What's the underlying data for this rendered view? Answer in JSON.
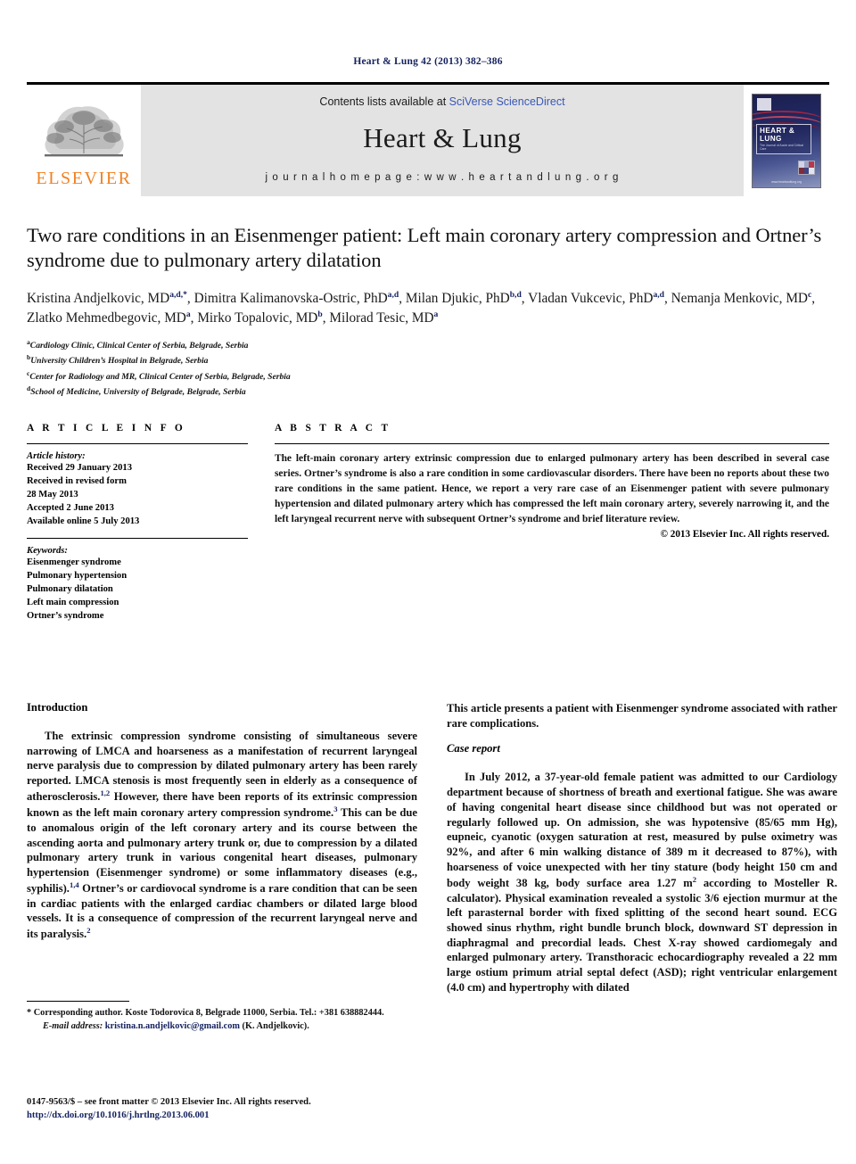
{
  "running_head": "Heart & Lung 42 (2013) 382–386",
  "masthead": {
    "publisher_logo_text": "ELSEVIER",
    "contents_prefix": "Contents lists available at ",
    "contents_link": "SciVerse ScienceDirect",
    "journal_name": "Heart & Lung",
    "homepage": "j o u r n a l   h o m e p a g e :   w w w . h e a r t a n d l u n g . o r g",
    "cover": {
      "title": "HEART & LUNG",
      "subtitle": "The Journal of Acute and Critical Care",
      "footer": "www.heartandlung.org"
    }
  },
  "article": {
    "title": "Two rare conditions in an Eisenmenger patient: Left main coronary artery compression and Ortner’s syndrome due to pulmonary artery dilatation",
    "authors_line_1": "Kristina Andjelkovic, MD",
    "authors_html": "Kristina Andjelkovic, MD a,d,*, Dimitra Kalimanovska-Ostric, PhD a,d, Milan Djukic, PhD b,d, Vladan Vukcevic, PhD a,d, Nemanja Menkovic, MD c, Zlatko Mehmedbegovic, MD a, Mirko Topalovic, MD b, Milorad Tesic, MD a",
    "authors": [
      {
        "name": "Kristina Andjelkovic, MD",
        "sup": "a,d,*"
      },
      {
        "name": "Dimitra Kalimanovska-Ostric, PhD",
        "sup": "a,d"
      },
      {
        "name": "Milan Djukic, PhD",
        "sup": "b,d"
      },
      {
        "name": "Vladan Vukcevic, PhD",
        "sup": "a,d"
      },
      {
        "name": "Nemanja Menkovic, MD",
        "sup": "c"
      },
      {
        "name": "Zlatko Mehmedbegovic, MD",
        "sup": "a"
      },
      {
        "name": "Mirko Topalovic, MD",
        "sup": "b"
      },
      {
        "name": "Milorad Tesic, MD",
        "sup": "a"
      }
    ],
    "affiliations": [
      {
        "sup": "a",
        "text": "Cardiology Clinic, Clinical Center of Serbia, Belgrade, Serbia"
      },
      {
        "sup": "b",
        "text": "University Children’s Hospital in Belgrade, Serbia"
      },
      {
        "sup": "c",
        "text": "Center for Radiology and MR, Clinical Center of Serbia, Belgrade, Serbia"
      },
      {
        "sup": "d",
        "text": "School of Medicine, University of Belgrade, Belgrade, Serbia"
      }
    ]
  },
  "article_info": {
    "heading": "A R T I C L E   I N F O",
    "history_label": "Article history:",
    "history": [
      "Received 29 January 2013",
      "Received in revised form",
      "28 May 2013",
      "Accepted 2 June 2013",
      "Available online 5 July 2013"
    ],
    "keywords_label": "Keywords:",
    "keywords": [
      "Eisenmenger syndrome",
      "Pulmonary hypertension",
      "Pulmonary dilatation",
      "Left main compression",
      "Ortner’s syndrome"
    ]
  },
  "abstract": {
    "heading": "A B S T R A C T",
    "text": "The left-main coronary artery extrinsic compression due to enlarged pulmonary artery has been described in several case series. Ortner’s syndrome is also a rare condition in some cardiovascular disorders. There have been no reports about these two rare conditions in the same patient. Hence, we report a very rare case of an Eisenmenger patient with severe pulmonary hypertension and dilated pulmonary artery which has compressed the left main coronary artery, severely narrowing it, and the left laryngeal recurrent nerve with subsequent Ortner’s syndrome and brief literature review.",
    "copyright": "© 2013 Elsevier Inc. All rights reserved."
  },
  "body": {
    "left": {
      "heading": "Introduction",
      "paragraph_1_a": "The extrinsic compression syndrome consisting of simultaneous severe narrowing of LMCA and hoarseness as a manifestation of recurrent laryngeal nerve paralysis due to compression by dilated pulmonary artery has been rarely reported. LMCA stenosis is most frequently seen in elderly as a consequence of atherosclerosis.",
      "ref_1": "1,2",
      "paragraph_1_b": " However, there have been reports of its extrinsic compression known as the left main coronary artery compression syndrome.",
      "ref_2": "3",
      "paragraph_1_c": " This can be due to anomalous origin of the left coronary artery and its course between the ascending aorta and pulmonary artery trunk or, due to compression by a dilated pulmonary artery trunk in various congenital heart diseases, pulmonary hypertension (Eisenmenger syndrome) or some inflammatory diseases (e.g., syphilis).",
      "ref_3": "1,4",
      "paragraph_1_d": " Ortner’s or cardiovocal syndrome is a rare condition that can be seen in cardiac patients with the enlarged cardiac chambers or dilated large blood vessels. It is a consequence of compression of the recurrent laryngeal nerve and its paralysis.",
      "ref_4": "2"
    },
    "right": {
      "lead_paragraph": "This article presents a patient with Eisenmenger syndrome associated with rather rare complications.",
      "heading": "Case report",
      "paragraph_1": "In July 2012, a 37-year-old female patient was admitted to our Cardiology department because of shortness of breath and exertional fatigue. She was aware of having congenital heart disease since childhood but was not operated or regularly followed up. On admission, she was hypotensive (85/65 mm Hg), eupneic, cyanotic (oxygen saturation at rest, measured by pulse oximetry was 92%, and after 6 min walking distance of 389 m it decreased to 87%), with hoarseness of voice unexpected with her tiny stature (body height 150 cm and body weight 38 kg, body surface area 1.27 m",
      "sup_m2": "2",
      "paragraph_1_cont": " according to Mosteller R. calculator). Physical examination revealed a systolic 3/6 ejection murmur at the left parasternal border with fixed splitting of the second heart sound. ECG showed sinus rhythm, right bundle brunch block, downward ST depression in diaphragmal and precordial leads. Chest X-ray showed cardiomegaly and enlarged pulmonary artery. Transthoracic echocardiography revealed a 22 mm large ostium primum atrial septal defect (ASD); right ventricular enlargement (4.0 cm) and hypertrophy with dilated"
    }
  },
  "footnotes": {
    "corresponding_marker": "*",
    "corresponding_text": " Corresponding author. Koste Todorovica 8, Belgrade 11000, Serbia. Tel.: +381 638882444.",
    "email_label": "E-mail address:",
    "email": "kristina.n.andjelkovic@gmail.com",
    "email_owner": " (K. Andjelkovic)."
  },
  "colophon": {
    "issn_line": "0147-9563/$ – see front matter © 2013 Elsevier Inc. All rights reserved.",
    "doi": "http://dx.doi.org/10.1016/j.hrtlng.2013.06.001"
  },
  "colors": {
    "header_blue": "#13215e",
    "link_blue": "#3a57b5",
    "elsevier_orange": "#f08222",
    "masthead_grey": "#e3e3e3"
  }
}
